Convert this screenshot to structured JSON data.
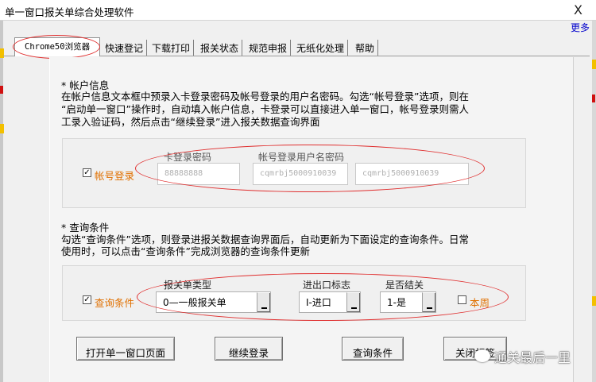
{
  "window": {
    "title": "单一窗口报关单综合处理软件",
    "close_glyph": "X",
    "more_link": "更多"
  },
  "tabs": [
    {
      "label": "Chrome50浏览器",
      "active": true
    },
    {
      "label": "快速登记"
    },
    {
      "label": "下载打印"
    },
    {
      "label": "报关状态"
    },
    {
      "label": "规范申报"
    },
    {
      "label": "无纸化处理"
    },
    {
      "label": "帮助"
    }
  ],
  "account_section": {
    "heading": "* 帐户信息",
    "description_line1": "在帐户信息文本框中预录入卡登录密码及帐号登录的用户名密码。勾选“帐号登录”选项，则在",
    "description_line2": "“启动单一窗口”操作时，自动填入帐户信息，卡登录可以直接进入单一窗口，帐号登录则需人",
    "description_line3": "工录入验证码，然后点击“继续登录”进入报关数据查询界面",
    "checkbox_label": "帐号登录",
    "checkbox_glyph": "✓",
    "card_password_label": "卡登录密码",
    "account_label": "帐号登录用户名密码",
    "card_password_value": "88888888",
    "username_value": "cqmrbj5000910039",
    "password_value": "cqmrbj5000910039"
  },
  "query_section": {
    "heading": "* 查询条件",
    "description_line1": "勾选“查询条件”选项，则登录进报关数据查询界面后，自动更新为下面设定的查询条件。日常",
    "description_line2": "使用时，可以点击“查询条件”完成浏览器的查询条件更新",
    "checkbox_label": "查询条件",
    "checkbox_glyph": "✓",
    "declaration_type_label": "报关单类型",
    "declaration_type_value": "0—一般报关单",
    "ie_flag_label": "进出口标志",
    "ie_flag_value": "I-进口",
    "closed_label": "是否结关",
    "closed_value": "1-是",
    "this_week_label": "本周"
  },
  "buttons": {
    "open_window": "打开单一窗口页面",
    "continue_login": "继续登录",
    "query_conditions": "查询条件",
    "close_tab": "关闭标签"
  },
  "watermark": "通关最后一里",
  "colors": {
    "accent_orange": "#e07000",
    "annotation_red": "#e03030",
    "link_blue": "#0000cc"
  }
}
